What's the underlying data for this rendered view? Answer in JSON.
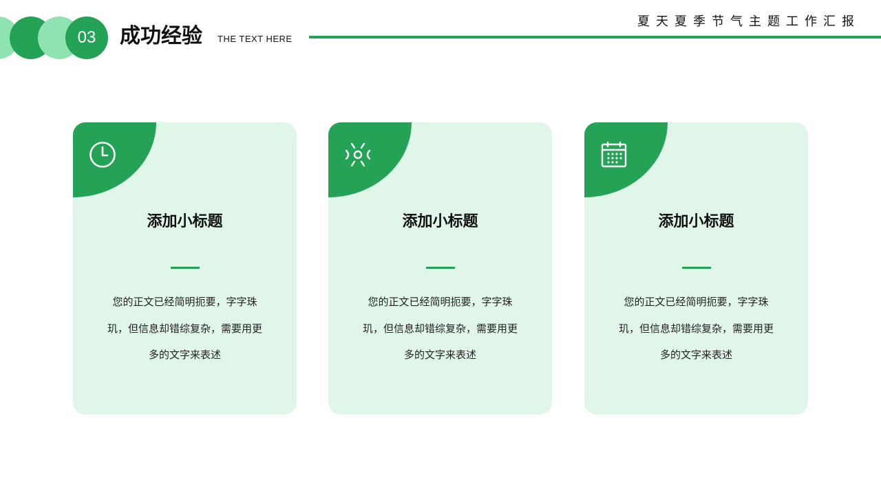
{
  "header": {
    "section_number": "03",
    "section_title": "成功经验",
    "section_subtitle": "THE TEXT HERE",
    "report_title": "夏天夏季节气主题工作汇报"
  },
  "colors": {
    "primary_green": "#24a356",
    "light_green": "#8fe3b0",
    "card_background": "#e0f6e8"
  },
  "cards": [
    {
      "icon": "clock-icon",
      "title": "添加小标题",
      "body": "您的正文已经简明扼要，字字珠玑，但信息却错综复杂，需要用更多的文字来表述"
    },
    {
      "icon": "burst-icon",
      "title": "添加小标题",
      "body": "您的正文已经简明扼要，字字珠玑，但信息却错综复杂，需要用更多的文字来表述"
    },
    {
      "icon": "calendar-icon",
      "title": "添加小标题",
      "body": "您的正文已经简明扼要，字字珠玑，但信息却错综复杂，需要用更多的文字来表述"
    }
  ]
}
